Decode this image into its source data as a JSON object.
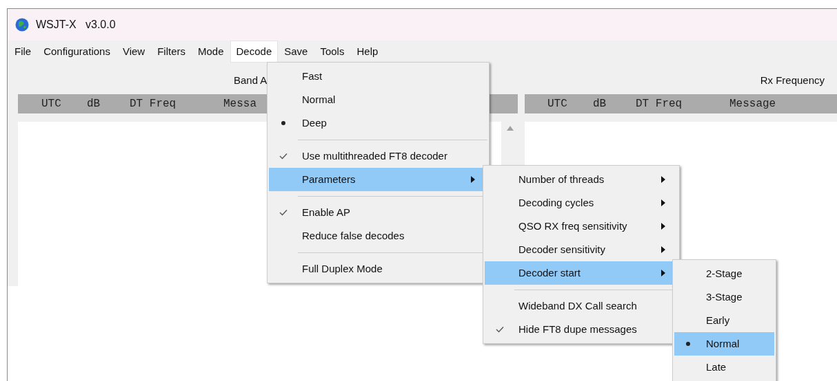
{
  "window": {
    "title": "WSJT-X   v3.0.0"
  },
  "menu_bar": [
    {
      "label": "File",
      "selected": false
    },
    {
      "label": "Configurations",
      "selected": false
    },
    {
      "label": "View",
      "selected": false
    },
    {
      "label": "Filters",
      "selected": false
    },
    {
      "label": "Mode",
      "selected": false
    },
    {
      "label": "Decode",
      "selected": true
    },
    {
      "label": "Save",
      "selected": false
    },
    {
      "label": "Tools",
      "selected": false
    },
    {
      "label": "Help",
      "selected": false
    }
  ],
  "band_activity": {
    "title": "Band A",
    "columns": [
      "UTC",
      "dB",
      "DT Freq",
      "Messa"
    ]
  },
  "rx_frequency": {
    "title": "Rx Frequency",
    "columns": [
      "UTC",
      "dB",
      "DT Freq",
      "Message"
    ]
  },
  "decode_menu": [
    {
      "kind": "radio",
      "label": "Fast",
      "checked": false,
      "highlighted": false,
      "submenu": false
    },
    {
      "kind": "radio",
      "label": "Normal",
      "checked": false,
      "highlighted": false,
      "submenu": false
    },
    {
      "kind": "radio",
      "label": "Deep",
      "checked": true,
      "highlighted": false,
      "submenu": false
    },
    {
      "kind": "separator"
    },
    {
      "kind": "check",
      "label": "Use multithreaded FT8 decoder",
      "checked": true,
      "highlighted": false,
      "submenu": false
    },
    {
      "kind": "plain",
      "label": "Parameters",
      "highlighted": true,
      "submenu": true
    },
    {
      "kind": "separator"
    },
    {
      "kind": "check",
      "label": "Enable AP",
      "checked": true,
      "highlighted": false,
      "submenu": false
    },
    {
      "kind": "check",
      "label": "Reduce false decodes",
      "checked": false,
      "highlighted": false,
      "submenu": false
    },
    {
      "kind": "separator"
    },
    {
      "kind": "check",
      "label": "Full Duplex Mode",
      "checked": false,
      "highlighted": false,
      "submenu": false
    }
  ],
  "parameters_menu": [
    {
      "kind": "plain",
      "label": "Number of threads",
      "highlighted": false,
      "submenu": true
    },
    {
      "kind": "plain",
      "label": "Decoding cycles",
      "highlighted": false,
      "submenu": true
    },
    {
      "kind": "plain",
      "label": "QSO RX freq sensitivity",
      "highlighted": false,
      "submenu": true
    },
    {
      "kind": "plain",
      "label": "Decoder sensitivity",
      "highlighted": false,
      "submenu": true
    },
    {
      "kind": "plain",
      "label": "Decoder start",
      "highlighted": true,
      "submenu": true
    },
    {
      "kind": "separator"
    },
    {
      "kind": "check",
      "label": "Wideband DX Call search",
      "checked": false,
      "highlighted": false,
      "submenu": false
    },
    {
      "kind": "check",
      "label": "Hide FT8 dupe messages",
      "checked": true,
      "highlighted": false,
      "submenu": false
    }
  ],
  "decoder_start_menu": [
    {
      "kind": "radio",
      "label": "2-Stage",
      "checked": false,
      "highlighted": false,
      "submenu": false
    },
    {
      "kind": "radio",
      "label": "3-Stage",
      "checked": false,
      "highlighted": false,
      "submenu": false
    },
    {
      "kind": "radio",
      "label": "Early",
      "checked": false,
      "highlighted": false,
      "submenu": false
    },
    {
      "kind": "radio",
      "label": "Normal",
      "checked": true,
      "highlighted": true,
      "submenu": false
    },
    {
      "kind": "radio",
      "label": "Late",
      "checked": false,
      "highlighted": false,
      "submenu": false
    }
  ]
}
